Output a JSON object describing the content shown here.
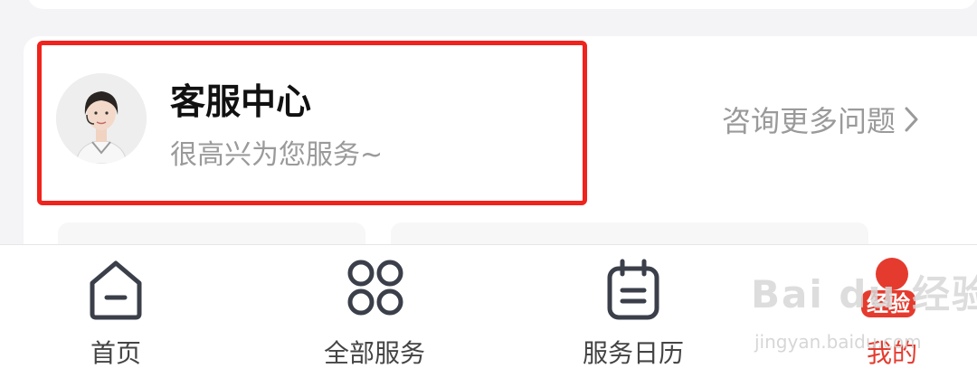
{
  "service_center": {
    "title": "客服中心",
    "subtitle": "很高兴为您服务~",
    "more_link": "咨询更多问题",
    "avatar_icon": "customer-service-agent-avatar"
  },
  "tabbar": {
    "items": [
      {
        "label": "首页",
        "icon": "home-icon",
        "active": false
      },
      {
        "label": "全部服务",
        "icon": "grid-circles-icon",
        "active": false
      },
      {
        "label": "服务日历",
        "icon": "calendar-icon",
        "active": false
      },
      {
        "label": "我的",
        "icon": "profile-icon",
        "active": true
      }
    ],
    "badge": "经验"
  },
  "watermark": {
    "brand": "Bai du 经验",
    "url": "jingyan.baidu.com"
  },
  "colors": {
    "highlight": "#f0231d",
    "accent": "#e43b2e",
    "text_primary": "#111111",
    "text_secondary": "#9a9a9a"
  }
}
